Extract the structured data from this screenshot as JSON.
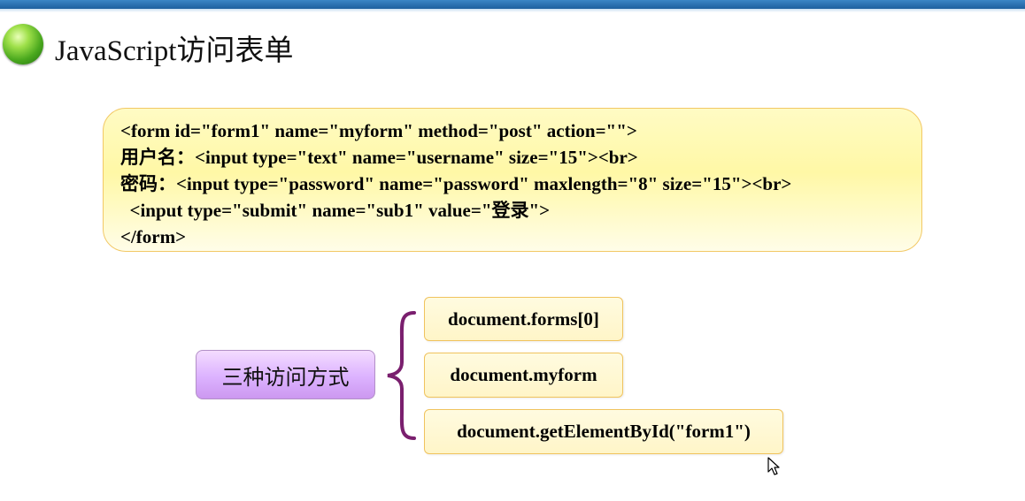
{
  "slide": {
    "title": "JavaScript访问表单"
  },
  "code": {
    "lines": [
      "<form id=\"form1\" name=\"myform\" method=\"post\" action=\"\">",
      "用户名：<input type=\"text\" name=\"username\" size=\"15\"><br>",
      "密码：<input type=\"password\" name=\"password\" maxlength=\"8\" size=\"15\"><br>",
      "  <input type=\"submit\" name=\"sub1\" value=\"登录\">",
      "</form>"
    ]
  },
  "diagram": {
    "root_label": "三种访问方式",
    "methods": [
      "document.forms[0]",
      "document.myform",
      "document.getElementById(\"form1\")"
    ],
    "colors": {
      "brace": "#7a1f6e",
      "code_box_fill": "#fff8a6",
      "code_box_border": "#f2c865",
      "root_box_fill": "#dcb2ff",
      "method_box_fill": "#fff5c8",
      "method_box_border": "#f0c35e",
      "top_bar": "#2a73b5",
      "bullet": "#4aa81e"
    }
  },
  "icons": {
    "bullet": "green-orb-icon",
    "cursor": "mouse-pointer-icon"
  }
}
